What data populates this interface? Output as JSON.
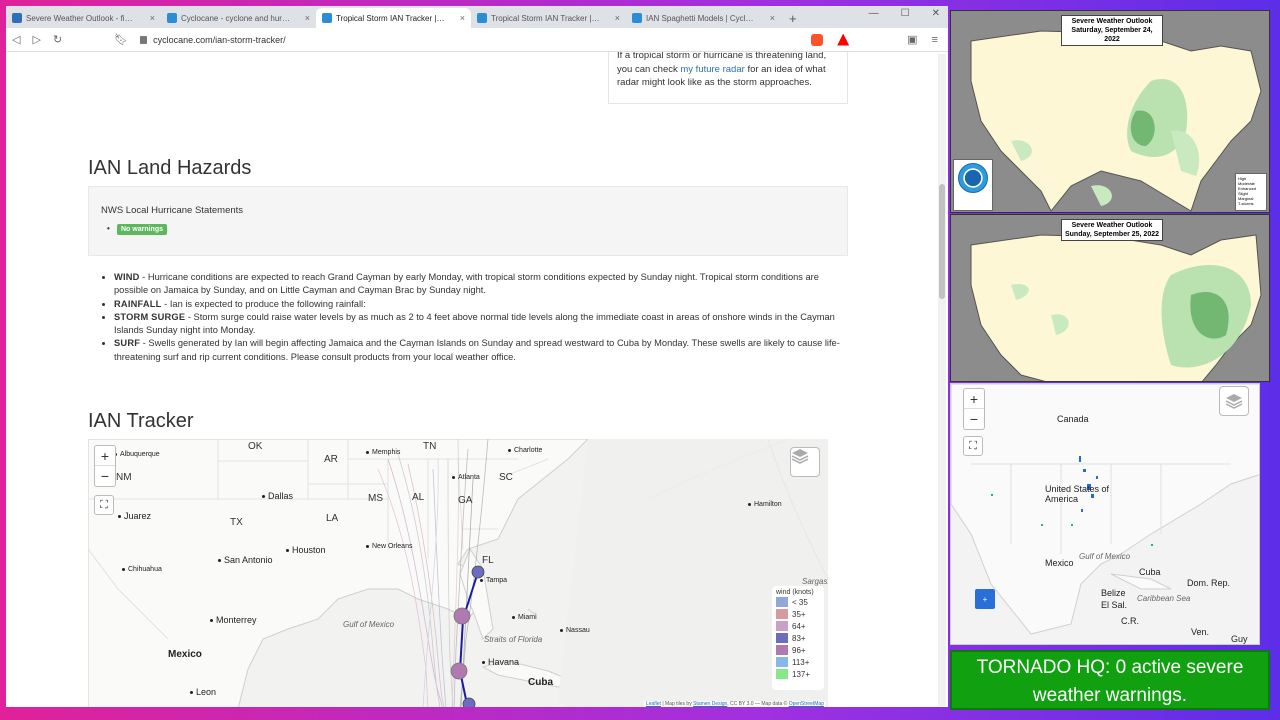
{
  "browser": {
    "tabs": [
      {
        "title": "Severe Weather Outlook - find out a",
        "fav_color": "#2f6fba",
        "active": false
      },
      {
        "title": "Cyclocane - cyclone and hurricane tr",
        "fav_color": "#2d8cd6",
        "active": false
      },
      {
        "title": "Tropical Storm IAN Tracker | Cyc",
        "fav_color": "#2d8cd6",
        "active": true
      },
      {
        "title": "Tropical Storm IAN Tracker | Cycloca",
        "fav_color": "#2d8cd6",
        "active": false
      },
      {
        "title": "IAN Spaghetti Models | Cyclocane",
        "fav_color": "#2d8cd6",
        "active": false
      }
    ],
    "newtab": "+",
    "url": "cyclocane.com/ian-storm-tracker/",
    "brave_badge": "4"
  },
  "radar_box": {
    "line1": "If a tropical storm or hurricane is threatening land,",
    "pre": "you can check",
    "link": "my future radar",
    "post": "for an idea of what",
    "line3": "radar might look like as the storm approaches."
  },
  "land_hazards": {
    "heading": "IAN Land Hazards",
    "statements_label": "NWS Local Hurricane Statements",
    "badge": "No warnings",
    "items": [
      {
        "label": "WIND",
        "text": " - Hurricane conditions are expected to reach Grand Cayman by early Monday, with tropical storm conditions expected by Sunday night. Tropical storm conditions are possible on Jamaica by Sunday, and on Little Cayman and Cayman Brac by Sunday night."
      },
      {
        "label": "RAINFALL",
        "text": " - Ian is expected to produce the following rainfall:"
      },
      {
        "label": "STORM SURGE",
        "text": " - Storm surge could raise water levels by as much as 2 to 4 feet above normal tide levels along the immediate coast in areas of onshore winds in the Cayman Islands Sunday night into Monday."
      },
      {
        "label": "SURF",
        "text": " - Swells generated by Ian will begin affecting Jamaica and the Cayman Islands on Sunday and spread westward to Cuba by Monday. These swells are likely to cause life-threatening surf and rip current conditions. Please consult products from your local weather office."
      }
    ]
  },
  "tracker": {
    "heading": "IAN Tracker",
    "zoom_in": "+",
    "zoom_out": "−",
    "fullscreen": "⛶",
    "states": [
      "OK",
      "AR",
      "TN",
      "NM",
      "MS",
      "AL",
      "GA",
      "SC",
      "TX",
      "LA",
      "FL"
    ],
    "cities": [
      "Albuquerque",
      "Memphis",
      "Charlotte",
      "Atlanta",
      "Dallas",
      "Juarez",
      "Hamilton",
      "New Orleans",
      "Houston",
      "Chihuahua",
      "San Antonio",
      "Tampa",
      "Monterrey",
      "Miami",
      "Nassau",
      "Havana",
      "Leon"
    ],
    "countries": [
      "Mexico",
      "Cuba"
    ],
    "seas": [
      "Gulf of Mexico",
      "Straits of Florida",
      "Sargasso"
    ],
    "legend_title": "wind (knots)",
    "legend": [
      {
        "label": "< 35",
        "color": "#8fa8d8"
      },
      {
        "label": "35+",
        "color": "#d89a9a"
      },
      {
        "label": "64+",
        "color": "#c8a0c8"
      },
      {
        "label": "83+",
        "color": "#6d6dc0"
      },
      {
        "label": "96+",
        "color": "#b07ab0"
      },
      {
        "label": "113+",
        "color": "#88b8e8"
      },
      {
        "label": "137+",
        "color": "#88e888"
      }
    ],
    "attribution_leaflet": "Leaflet",
    "attribution_mid": " | Map tiles by ",
    "attribution_stamen": "Stamen Design",
    "attribution_cc": ", CC BY 3.0",
    "attribution_data": " — Map data © ",
    "attribution_osm": "OpenStreetMap"
  },
  "side": {
    "outlook1_title": "Severe Weather Outlook\nSaturday, September 24, 2022",
    "outlook2_title": "Severe Weather Outlook\nSunday, September 25, 2022",
    "legend_items": [
      "High",
      "Moderate",
      "Enhanced",
      "Slight",
      "Marginal",
      "T-storms"
    ],
    "minimap_labels": [
      "Canada",
      "United States of America",
      "Gulf of Mexico",
      "Mexico",
      "Cuba",
      "Dom. Rep.",
      "Belize",
      "El Sal.",
      "Caribbean Sea",
      "C.R.",
      "Ven.",
      "Guy"
    ],
    "tornado_text": "TORNADO HQ: 0 active severe weather warnings."
  }
}
